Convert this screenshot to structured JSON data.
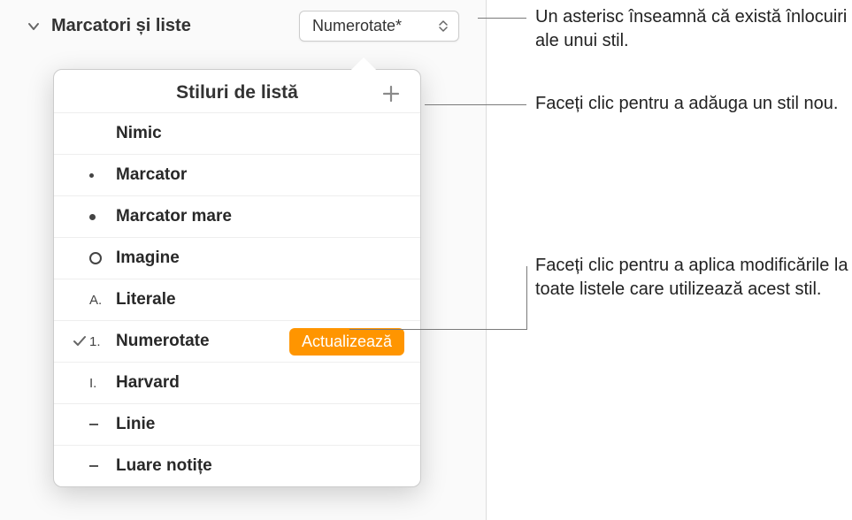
{
  "header": {
    "label": "Marcatori și liste",
    "dropdown_value": "Numerotate*"
  },
  "popover": {
    "title": "Stiluri de listă",
    "update_label": "Actualizează",
    "items": [
      {
        "marker_type": "none",
        "label": "Nimic",
        "checked": false,
        "has_update": false
      },
      {
        "marker_type": "dot",
        "label": "Marcator",
        "checked": false,
        "has_update": false
      },
      {
        "marker_type": "dotlg",
        "label": "Marcator mare",
        "checked": false,
        "has_update": false
      },
      {
        "marker_type": "ring",
        "label": "Imagine",
        "checked": false,
        "has_update": false
      },
      {
        "marker_type": "text",
        "marker": "A.",
        "label": "Literale",
        "checked": false,
        "has_update": false
      },
      {
        "marker_type": "text",
        "marker": "1.",
        "label": "Numerotate",
        "checked": true,
        "has_update": true
      },
      {
        "marker_type": "text",
        "marker": "I.",
        "label": "Harvard",
        "checked": false,
        "has_update": false
      },
      {
        "marker_type": "dash",
        "label": "Linie",
        "checked": false,
        "has_update": false
      },
      {
        "marker_type": "dash",
        "label": "Luare notițe",
        "checked": false,
        "has_update": false
      }
    ]
  },
  "callouts": {
    "asterisk": "Un asterisc înseamnă că există înlocuiri ale unui stil.",
    "add": "Faceți clic pentru a adăuga un stil nou.",
    "update": "Faceți clic pentru a aplica modificările la toate listele care utilizează acest stil."
  }
}
